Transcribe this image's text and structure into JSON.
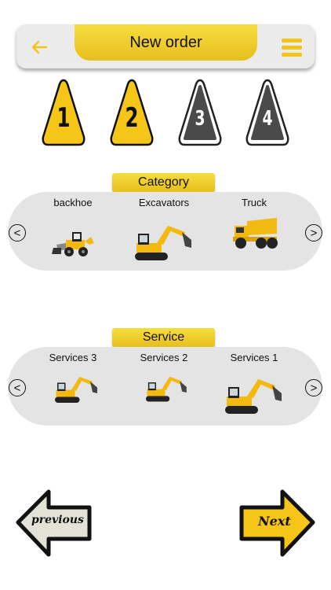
{
  "header": {
    "title": "New order",
    "back_icon": "arrow-left-icon",
    "menu_icon": "hamburger-menu-icon",
    "accent": "#f0c419"
  },
  "steps": [
    {
      "label": "1",
      "state": "active"
    },
    {
      "label": "2",
      "state": "active"
    },
    {
      "label": "3",
      "state": "inactive"
    },
    {
      "label": "4",
      "state": "inactive"
    }
  ],
  "category": {
    "title": "Category",
    "prev": "<",
    "next": ">",
    "items": [
      {
        "label": "backhoe",
        "icon": "backhoe-loader-icon"
      },
      {
        "label": "Excavators",
        "icon": "excavator-icon"
      },
      {
        "label": "Truck",
        "icon": "dump-truck-icon"
      }
    ]
  },
  "service": {
    "title": "Service",
    "prev": "<",
    "next": ">",
    "items": [
      {
        "label": "Services 3",
        "icon": "excavator-icon"
      },
      {
        "label": "Services 2",
        "icon": "excavator-icon"
      },
      {
        "label": "Services 1",
        "icon": "excavator-icon"
      }
    ]
  },
  "footer": {
    "previous_label": "previous",
    "next_label": "Next"
  }
}
